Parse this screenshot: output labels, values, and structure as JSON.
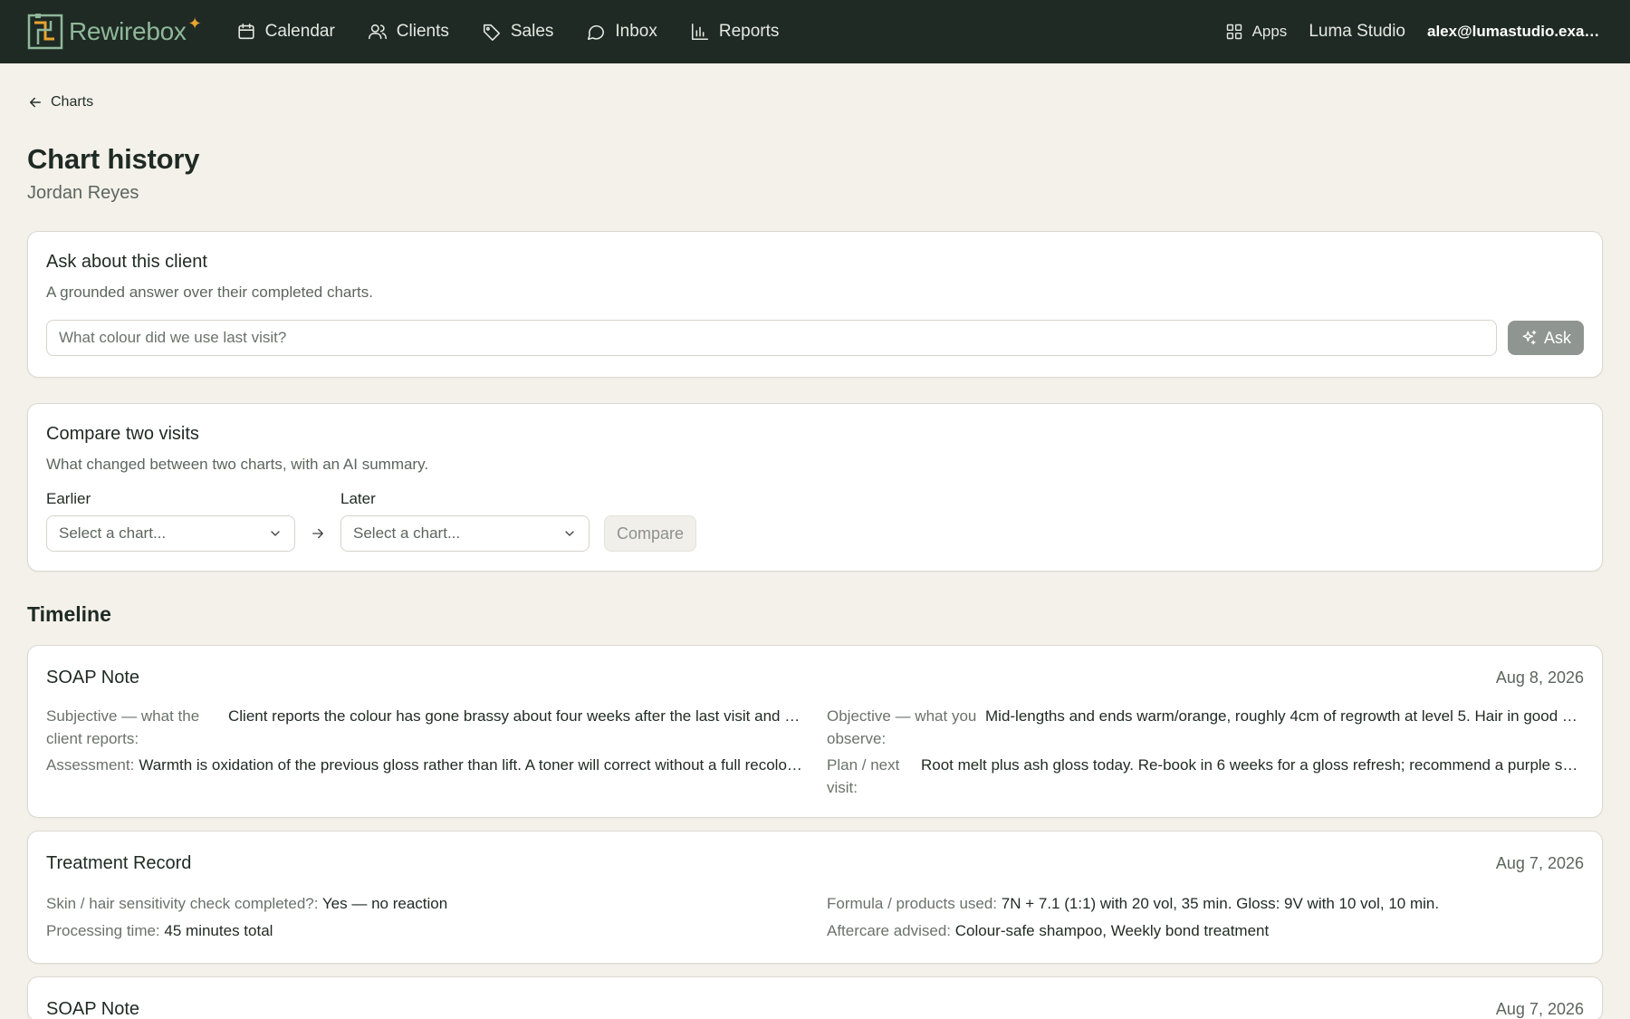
{
  "brand": {
    "name": "Rewirebox",
    "accent": "#e8a431",
    "bar_bg": "#1f2a24"
  },
  "nav": {
    "items": [
      {
        "label": "Calendar",
        "icon": "calendar-icon"
      },
      {
        "label": "Clients",
        "icon": "users-icon"
      },
      {
        "label": "Sales",
        "icon": "tag-icon"
      },
      {
        "label": "Inbox",
        "icon": "chat-icon"
      },
      {
        "label": "Reports",
        "icon": "bar-chart-icon"
      }
    ],
    "apps_label": "Apps",
    "studio": "Luma Studio",
    "email": "alex@lumastudio.example.com"
  },
  "breadcrumb": {
    "label": "Charts"
  },
  "page": {
    "title": "Chart history",
    "client_name": "Jordan Reyes"
  },
  "ask": {
    "title": "Ask about this client",
    "description": "A grounded answer over their completed charts.",
    "placeholder": "What colour did we use last visit?",
    "button": "Ask"
  },
  "compare": {
    "title": "Compare two visits",
    "description": "What changed between two charts, with an AI summary.",
    "earlier_label": "Earlier",
    "later_label": "Later",
    "earlier_placeholder": "Select a chart...",
    "later_placeholder": "Select a chart...",
    "button": "Compare"
  },
  "timeline": {
    "title": "Timeline",
    "entries": [
      {
        "type": "SOAP Note",
        "date": "Aug 8, 2026",
        "subjective_label": "Subjective — what the client reports:",
        "subjective": "Client reports the colour has gone brassy about four weeks after the last visit and wants it cooler.",
        "objective_label": "Objective — what you observe:",
        "objective": "Mid-lengths and ends warm/orange, roughly 4cm of regrowth at level 5. Hair in good condition.",
        "assessment_label": "Assessment:",
        "assessment": "Warmth is oxidation of the previous gloss rather than lift. A toner will correct without a full recolour.",
        "plan_label": "Plan / next visit:",
        "plan": "Root melt plus ash gloss today. Re-book in 6 weeks for a gloss refresh; recommend a purple shampoo."
      },
      {
        "type": "Treatment Record",
        "date": "Aug 7, 2026",
        "sensitivity_label": "Skin / hair sensitivity check completed?:",
        "sensitivity": "Yes — no reaction",
        "formula_label": "Formula / products used:",
        "formula": "7N + 7.1 (1:1) with 20 vol, 35 min. Gloss: 9V with 10 vol, 10 min.",
        "processing_label": "Processing time:",
        "processing": "45 minutes total",
        "aftercare_label": "Aftercare advised:",
        "aftercare": "Colour-safe shampoo, Weekly bond treatment"
      },
      {
        "type": "SOAP Note",
        "date": "Aug 7, 2026"
      }
    ]
  }
}
